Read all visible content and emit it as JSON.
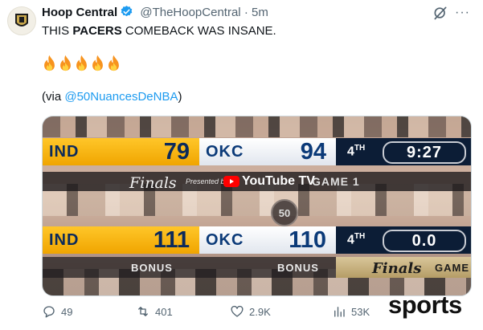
{
  "header": {
    "display_name": "Hoop Central",
    "handle": "@TheHoopCentral",
    "separator": "·",
    "time": "5m"
  },
  "tweet": {
    "text_before": "THIS ",
    "text_bold": "PACERS",
    "text_after": " COMEBACK WAS INSANE.",
    "emoji_icons": [
      "fire-icon",
      "fire-icon",
      "fire-icon",
      "fire-icon",
      "fire-icon"
    ],
    "via_prefix": "(via ",
    "via_mention": "@50NuancesDeNBA",
    "via_suffix": ")"
  },
  "media": {
    "scoreboard_top": {
      "team1": "IND",
      "score1": "79",
      "team2": "OKC",
      "score2": "94",
      "period": "4",
      "period_suffix": "TH",
      "clock": "9:27"
    },
    "strip_top": {
      "finals": "Finals",
      "presented_by": "Presented by",
      "sponsor": "YouTube TV",
      "game": "GAME 1"
    },
    "center_logo": "50",
    "scoreboard_bottom": {
      "team1": "IND",
      "score1": "111",
      "team2": "OKC",
      "score2": "110",
      "period": "4",
      "period_suffix": "TH",
      "clock": "0.0"
    },
    "strip_bottom": {
      "bonus_left": "BONUS",
      "bonus_right": "BONUS",
      "finals": "Finals",
      "game": "GAME"
    }
  },
  "actions": {
    "replies": "49",
    "reposts": "401",
    "likes": "2.9K",
    "views": "53K"
  },
  "watermark": "sports",
  "colors": {
    "accent": "#1d9bf0",
    "verified": "#1d9bf0",
    "pacers_gold": "#ffc629",
    "navy": "#0c1d36"
  }
}
